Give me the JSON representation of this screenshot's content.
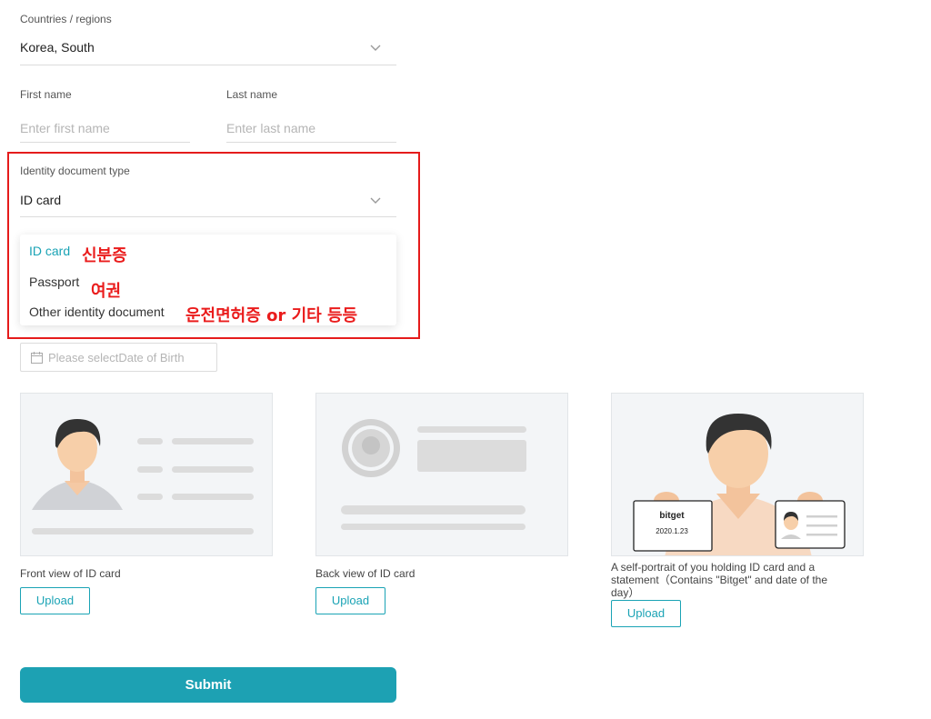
{
  "country": {
    "label": "Countries / regions",
    "value": "Korea, South"
  },
  "first_name": {
    "label": "First name",
    "placeholder": "Enter first name"
  },
  "last_name": {
    "label": "Last name",
    "placeholder": "Enter last name"
  },
  "doc_type": {
    "label": "Identity document type",
    "value": "ID card",
    "options": [
      {
        "label": "ID card",
        "annotation": "신분증",
        "selected": true
      },
      {
        "label": "Passport",
        "annotation": "여권"
      },
      {
        "label": "Other identity document",
        "annotation": "운전면허증 or 기타 등등"
      }
    ]
  },
  "dob": {
    "placeholder": "Please selectDate of Birth"
  },
  "uploads": [
    {
      "caption": "Front view of ID card",
      "button": "Upload"
    },
    {
      "caption": "Back view of ID card",
      "button": "Upload"
    },
    {
      "caption": "A self-portrait of you holding ID card and a statement（Contains \"Bitget\" and date of the day）",
      "button": "Upload",
      "card_text": "bitget",
      "card_date": "2020.1.23"
    }
  ],
  "submit_label": "Submit",
  "colors": {
    "accent": "#1da1b3",
    "annotation": "#ea1c1c"
  }
}
